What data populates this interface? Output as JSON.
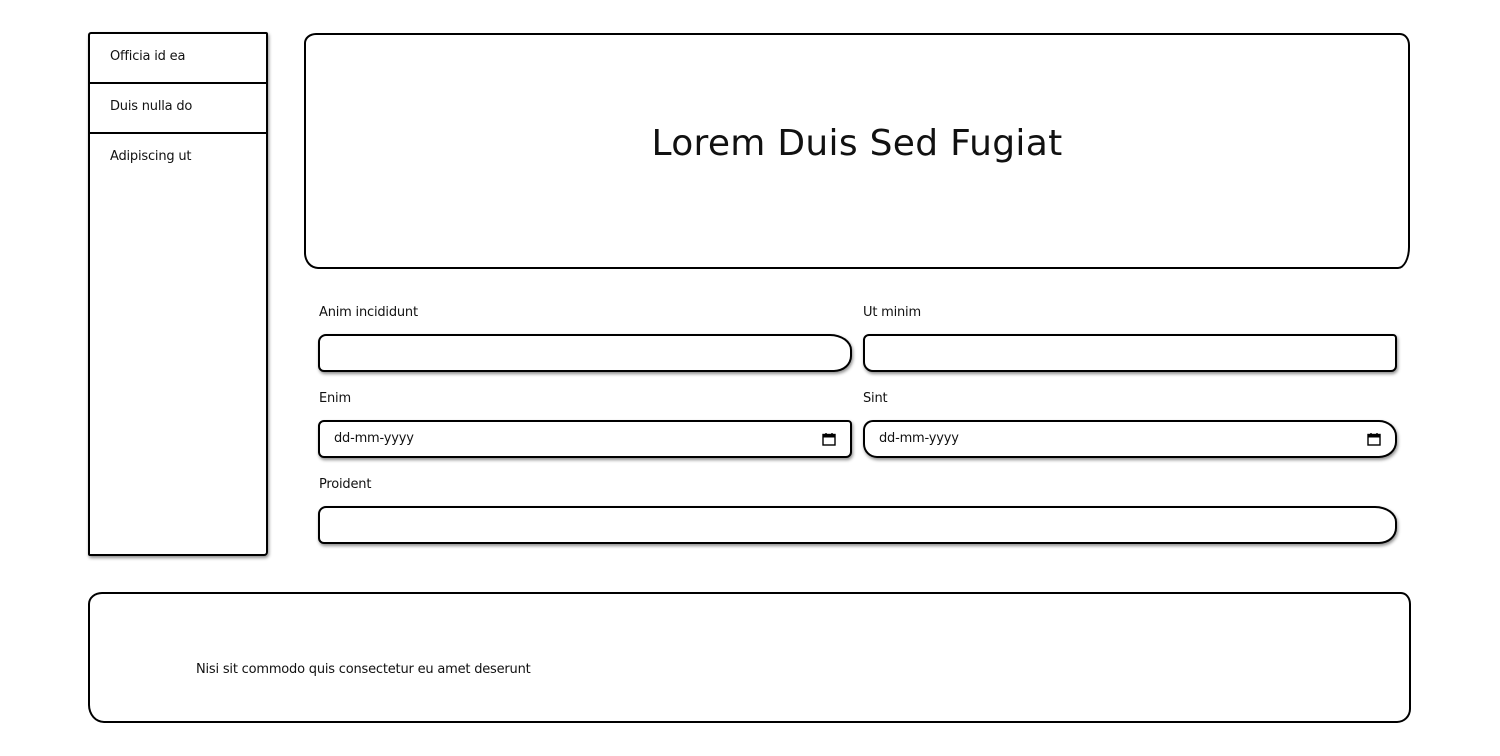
{
  "sidebar": {
    "items": [
      {
        "label": "Officia id ea"
      },
      {
        "label": "Duis nulla do"
      },
      {
        "label": "Adipiscing ut"
      }
    ]
  },
  "hero": {
    "title": "Lorem Duis Sed Fugiat"
  },
  "form": {
    "fields": [
      {
        "label": "Anim incididunt",
        "value": ""
      },
      {
        "label": "Ut minim",
        "value": ""
      },
      {
        "label": "Enim",
        "placeholder": "dd-mm-yyyy",
        "icon": "calendar-icon"
      },
      {
        "label": "Sint",
        "placeholder": "dd-mm-yyyy",
        "icon": "calendar-icon"
      },
      {
        "label": "Proident",
        "value": ""
      }
    ]
  },
  "footer": {
    "text": "Nisi sit commodo quis consectetur eu amet deserunt"
  },
  "colors": {
    "border": "#000000",
    "background": "#ffffff",
    "text": "#111111"
  }
}
